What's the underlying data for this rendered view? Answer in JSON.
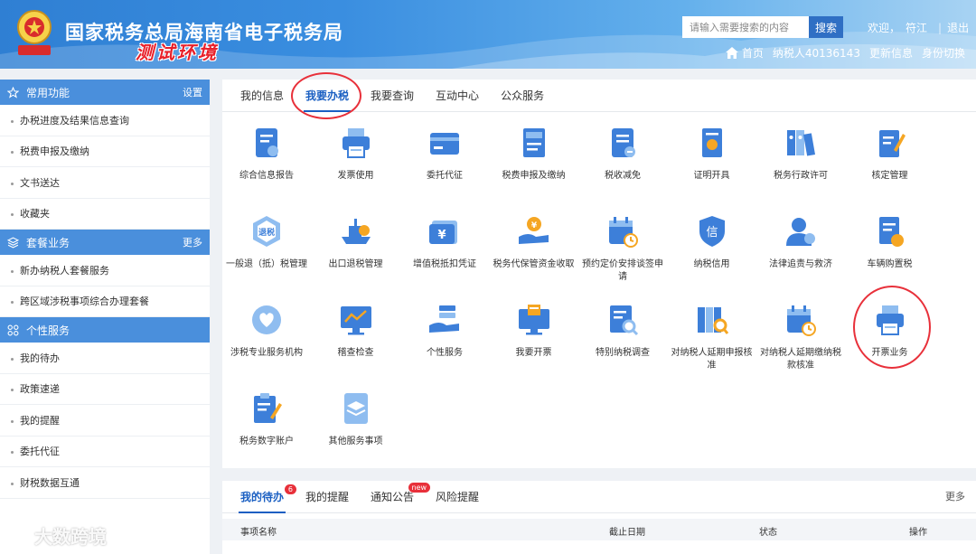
{
  "header": {
    "title": "国家税务总局海南省电子税务局",
    "env_label": "测试环境",
    "search_placeholder": "请输入需要搜索的内容",
    "search_button": "搜索",
    "welcome": "欢迎，",
    "user": "符江",
    "logout": "退出",
    "nav": {
      "home": "首页",
      "taxpayer": "纳税人40136143",
      "update": "更新信息",
      "switch": "身份切换"
    },
    "emblem_text": "中国税务"
  },
  "sidebar": {
    "sections": [
      {
        "title": "常用功能",
        "action": "设置",
        "icon": "star-icon",
        "items": [
          "办税进度及结果信息查询",
          "税费申报及缴纳",
          "文书送达",
          "收藏夹"
        ]
      },
      {
        "title": "套餐业务",
        "action": "更多",
        "icon": "package-icon",
        "items": [
          "新办纳税人套餐服务",
          "跨区域涉税事项综合办理套餐"
        ]
      },
      {
        "title": "个性服务",
        "action": "",
        "icon": "grid-icon",
        "items": [
          "我的待办",
          "政策速递",
          "我的提醒",
          "委托代征",
          "财税数据互通"
        ]
      }
    ]
  },
  "main": {
    "tabs": [
      "我的信息",
      "我要办税",
      "我要查询",
      "互动中心",
      "公众服务"
    ],
    "active_tab": 1,
    "services": [
      {
        "label": "综合信息报告",
        "icon": "report-icon"
      },
      {
        "label": "发票使用",
        "icon": "printer-icon"
      },
      {
        "label": "委托代征",
        "icon": "card-icon"
      },
      {
        "label": "税费申报及缴纳",
        "icon": "declare-icon"
      },
      {
        "label": "税收减免",
        "icon": "reduce-icon"
      },
      {
        "label": "证明开具",
        "icon": "certificate-icon"
      },
      {
        "label": "税务行政许可",
        "icon": "binders-icon"
      },
      {
        "label": "核定管理",
        "icon": "verify-icon"
      },
      {
        "label": "一般退（抵）税管理",
        "icon": "refund-icon"
      },
      {
        "label": "出口退税管理",
        "icon": "ship-icon"
      },
      {
        "label": "增值税抵扣凭证",
        "icon": "voucher-icon"
      },
      {
        "label": "税务代保管资金收取",
        "icon": "hand-coin-icon"
      },
      {
        "label": "预约定价安排谈签申请",
        "icon": "calendar-clock-icon"
      },
      {
        "label": "纳税信用",
        "icon": "credit-shield-icon"
      },
      {
        "label": "法律追责与救济",
        "icon": "person-icon"
      },
      {
        "label": "车辆购置税",
        "icon": "car-tax-icon"
      },
      {
        "label": "涉税专业服务机构",
        "icon": "heart-hand-icon"
      },
      {
        "label": "稽查检查",
        "icon": "monitor-chart-icon"
      },
      {
        "label": "个性服务",
        "icon": "hand-list-icon"
      },
      {
        "label": "我要开票",
        "icon": "invoice-monitor-icon"
      },
      {
        "label": "特别纳税调查",
        "icon": "search-doc-icon"
      },
      {
        "label": "对纳税人延期申报核准",
        "icon": "binders-search-icon"
      },
      {
        "label": "对纳税人延期缴纳税款核准",
        "icon": "calendar-clock-icon"
      },
      {
        "label": "开票业务",
        "icon": "printer-icon"
      },
      {
        "label": "税务数字账户",
        "icon": "clipboard-pen-icon"
      },
      {
        "label": "其他服务事项",
        "icon": "layers-doc-icon"
      }
    ]
  },
  "bottom": {
    "tabs": [
      {
        "label": "我的待办",
        "badge": "6"
      },
      {
        "label": "我的提醒",
        "badge": ""
      },
      {
        "label": "通知公告",
        "badge": "new"
      },
      {
        "label": "风险提醒",
        "badge": ""
      }
    ],
    "more": "更多",
    "columns": [
      "事项名称",
      "截止日期",
      "状态",
      "操作"
    ]
  },
  "watermark": "大数跨境",
  "colors": {
    "primary": "#1a5fc2",
    "header": "#3a8ee0",
    "sidebar_head": "#4a8fdc",
    "highlight": "#e8303a"
  }
}
